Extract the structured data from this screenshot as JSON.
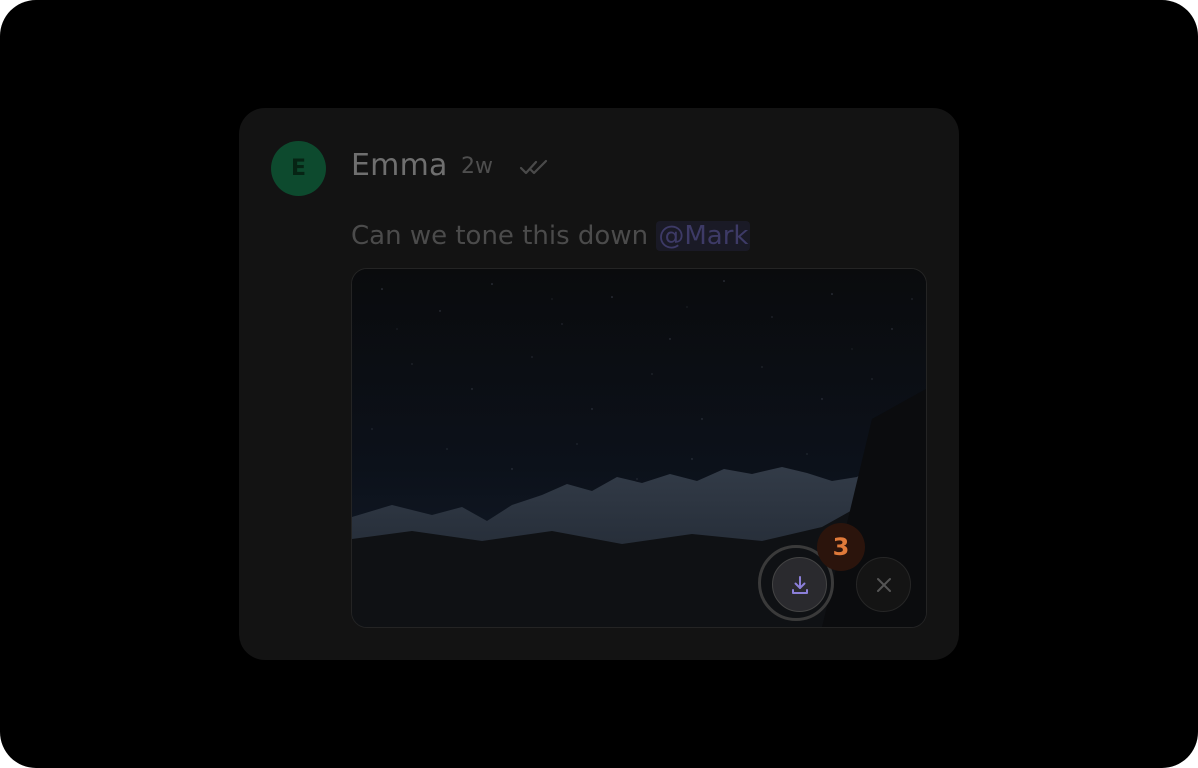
{
  "message": {
    "author": {
      "name": "Emma",
      "initial": "E"
    },
    "time": "2w",
    "status": "double-check-icon",
    "text": "Can we tone this down ",
    "mention": "@Mark"
  },
  "attachment": {
    "type": "image",
    "subject": "night mountain landscape with stars"
  },
  "actions": {
    "download_icon": "download-icon",
    "close_icon": "close-icon",
    "badge_count": "3"
  },
  "colors": {
    "avatar": "#0d4a2e",
    "badge_text": "#e07a3a",
    "mention": "#3d3a66",
    "download_icon": "#8b7fd9"
  }
}
